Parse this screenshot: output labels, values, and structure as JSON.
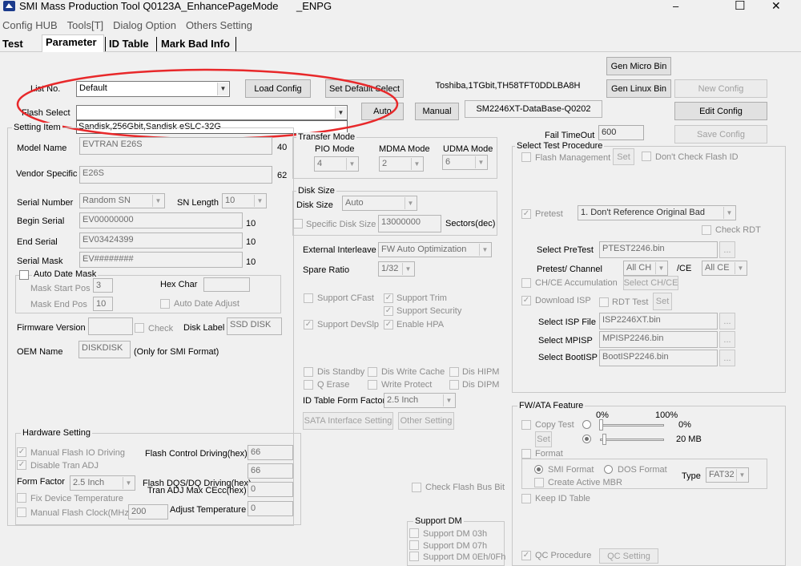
{
  "title": "SMI Mass Production Tool Q0123A_EnhancePageMode",
  "title_suffix": "_ENPG",
  "win": {
    "min": "–",
    "max": "☐",
    "close": "✕"
  },
  "menu": [
    "Config HUB",
    "Tools[T]",
    "Dialog Option",
    "Others Setting"
  ],
  "tabs": [
    "Test",
    "Parameter",
    "ID Table",
    "Mark Bad Info"
  ],
  "top": {
    "list_no": "List No.",
    "list_val": "Default",
    "load": "Load Config",
    "set_default": "Set Default Select",
    "flash_info": "Toshiba,1TGbit,TH58TFT0DDLBA8H",
    "gen_micro": "Gen Micro Bin",
    "gen_linux": "Gen Linux Bin",
    "new_config": "New Config",
    "flash_select": "Flash Select",
    "auto": "Auto",
    "manual": "Manual",
    "db": "SM2246XT-DataBase-Q0202",
    "edit_config": "Edit Config",
    "dropdown_item": "Sandisk,256Gbit,Sandisk eSLC-32G",
    "fail_label": "Fail TimeOut",
    "fail_val": "600",
    "save_config": "Save Config"
  },
  "setting": {
    "title": "Setting Item",
    "model_name": "Model Name",
    "model_val": "EVTRAN E26S",
    "model_n": "40",
    "vendor": "Vendor Specific",
    "vendor_val": "E26S",
    "vendor_n": "62",
    "serial_num": "Serial Number",
    "serial_val": "Random SN",
    "sn_len": "SN Length",
    "sn_len_val": "10",
    "begin": "Begin Serial",
    "begin_val": "EV00000000",
    "begin_n": "10",
    "end": "End Serial",
    "end_val": "EV03424399",
    "end_n": "10",
    "mask": "Serial Mask",
    "mask_val": "EV########",
    "mask_n": "10",
    "auto_mask": "Auto Date Mask",
    "mask_start": "Mask Start Pos",
    "mask_start_val": "3",
    "hex_char": "Hex Char",
    "mask_end": "Mask End Pos",
    "mask_end_val": "10",
    "auto_date": "Auto Date Adjust",
    "fw_ver": "Firmware Version",
    "check": "Check",
    "disk_label": "Disk Label",
    "disk_label_val": "SSD DISK",
    "oem": "OEM Name",
    "oem_val": "DISKDISK",
    "oem_note": "(Only for SMI Format)"
  },
  "transfer": {
    "title": "Transfer Mode",
    "pio": "PIO Mode",
    "pio_val": "4",
    "mdma": "MDMA Mode",
    "mdma_val": "2",
    "udma": "UDMA Mode",
    "udma_val": "6"
  },
  "disk": {
    "title": "Disk Size",
    "label": "Disk Size",
    "val": "Auto",
    "specific": "Specific Disk Size",
    "specific_val": "13000000",
    "sectors": "Sectors(dec)"
  },
  "mid": {
    "ext_il": "External Interleave",
    "ext_il_val": "FW Auto Optimization",
    "spare": "Spare Ratio",
    "spare_val": "1/32",
    "cfast": "Support CFast",
    "trim": "Support Trim",
    "security": "Support Security",
    "devslp": "Support DevSlp",
    "hpa": "Enable HPA",
    "dis_standby": "Dis Standby",
    "dis_wc": "Dis Write Cache",
    "dis_hipm": "Dis HIPM",
    "qerase": "Q Erase",
    "wp": "Write Protect",
    "dis_dipm": "Dis DIPM",
    "idtff": "ID Table Form Factor",
    "idtff_val": "2.5 Inch",
    "sata": "SATA Interface Setting",
    "other": "Other Setting",
    "check_flash_bus": "Check Flash Bus Bit"
  },
  "hw": {
    "title": "Hardware Setting",
    "manual_io": "Manual Flash IO Driving",
    "ctrl_drv": "Flash Control Driving(hex)",
    "ctrl_drv_val": "66",
    "dis_adj": "Disable Tran ADJ",
    "dqs_val": "66",
    "dqs": "Flash DQS/DQ Driving(hex)",
    "ff": "Form Factor",
    "ff_val": "2.5 Inch",
    "cecc": "Tran ADJ Max CEcc(hex)",
    "cecc_val": "0",
    "fix_temp": "Fix Device Temperature",
    "clock": "Manual Flash Clock(MHz)",
    "clock_val": "200",
    "adj_temp": "Adjust Temperature",
    "adj_temp_val": "0"
  },
  "dm": {
    "title": "Support DM",
    "d03": "Support DM 03h",
    "d07": "Support DM 07h",
    "d0e": "Support DM 0Eh/0Fh"
  },
  "proc": {
    "title": "Select Test Procedure",
    "flash_mgmt": "Flash Management",
    "set": "Set",
    "dont_check": "Don't Check Flash ID",
    "pretest": "Pretest",
    "pretest_val": "1. Don't Reference Original Bad",
    "check_rdt": "Check RDT",
    "sel_pre": "Select PreTest",
    "sel_pre_val": "PTEST2246.bin",
    "dots": "...",
    "pre_ch": "Pretest/ Channel",
    "allch": "All CH",
    "ce": "/CE",
    "allce": "All CE",
    "chce": "CH/CE Accumulation",
    "select_chce": "Select CH/CE",
    "dl_isp": "Download ISP",
    "rdt_test": "RDT Test",
    "sel_isp": "Select ISP File",
    "sel_isp_val": "ISP2246XT.bin",
    "sel_mp": "Select MPISP",
    "sel_mp_val": "MPISP2246.bin",
    "sel_boot": "Select BootISP",
    "sel_boot_val": "BootISP2246.bin"
  },
  "fw": {
    "title": "FW/ATA Feature",
    "p0": "0%",
    "p100": "100%",
    "copy_test": "Copy Test",
    "pct": "0%",
    "set": "Set",
    "mb": "20 MB",
    "format": "Format",
    "smi_fmt": "SMI Format",
    "dos_fmt": "DOS Format",
    "active_mbr": "Create Active MBR",
    "type": "Type",
    "type_val": "FAT32",
    "keep_id": "Keep ID Table",
    "qc": "QC Procedure",
    "qc_setting": "QC Setting"
  }
}
